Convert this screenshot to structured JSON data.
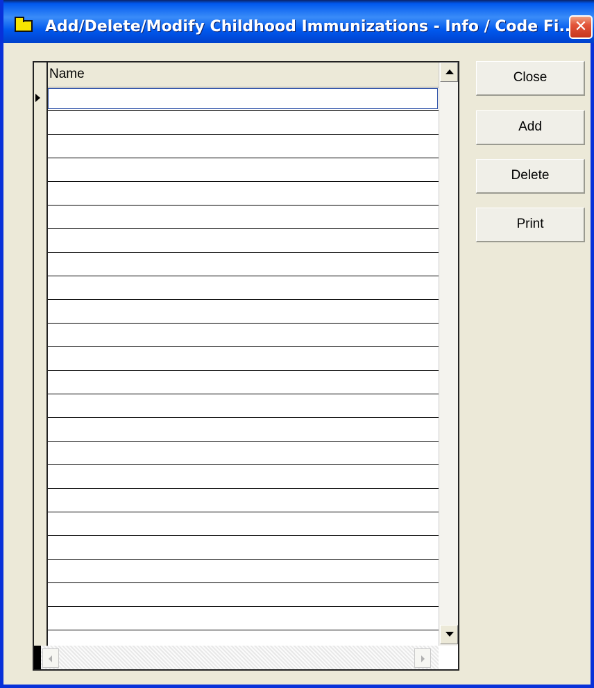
{
  "window": {
    "title": "Add/Delete/Modify Childhood Immunizations - Info / Code Fi...",
    "close_glyph": "✕"
  },
  "grid": {
    "columns": [
      {
        "label": "Name"
      }
    ],
    "rows": [
      {
        "name": ""
      },
      {
        "name": ""
      },
      {
        "name": ""
      },
      {
        "name": ""
      },
      {
        "name": ""
      },
      {
        "name": ""
      },
      {
        "name": ""
      },
      {
        "name": ""
      },
      {
        "name": ""
      },
      {
        "name": ""
      },
      {
        "name": ""
      },
      {
        "name": ""
      },
      {
        "name": ""
      },
      {
        "name": ""
      },
      {
        "name": ""
      },
      {
        "name": ""
      },
      {
        "name": ""
      },
      {
        "name": ""
      },
      {
        "name": ""
      },
      {
        "name": ""
      },
      {
        "name": ""
      },
      {
        "name": ""
      },
      {
        "name": ""
      },
      {
        "name": ""
      }
    ],
    "current_row_value": ""
  },
  "buttons": {
    "close": "Close",
    "add": "Add",
    "delete": "Delete",
    "print": "Print"
  },
  "colors": {
    "titlebar": "#0058ee",
    "window_bg": "#ece9d8",
    "close_button": "#e2543a"
  }
}
